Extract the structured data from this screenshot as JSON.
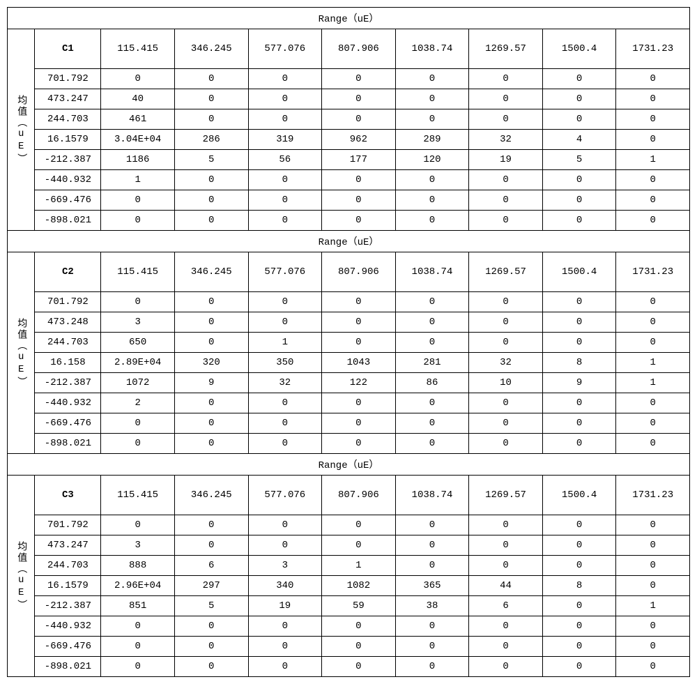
{
  "range_header": "Range（uE）",
  "vertical_label": "均值（uE）",
  "column_headers": [
    "115.415",
    "346.245",
    "577.076",
    "807.906",
    "1038.74",
    "1269.57",
    "1500.4",
    "1731.23"
  ],
  "sections": [
    {
      "name": "C1",
      "row_labels": [
        "701.792",
        "473.247",
        "244.703",
        "16.1579",
        "-212.387",
        "-440.932",
        "-669.476",
        "-898.021"
      ],
      "rows": [
        [
          "0",
          "0",
          "0",
          "0",
          "0",
          "0",
          "0",
          "0"
        ],
        [
          "40",
          "0",
          "0",
          "0",
          "0",
          "0",
          "0",
          "0"
        ],
        [
          "461",
          "0",
          "0",
          "0",
          "0",
          "0",
          "0",
          "0"
        ],
        [
          "3.04E+04",
          "286",
          "319",
          "962",
          "289",
          "32",
          "4",
          "0"
        ],
        [
          "1186",
          "5",
          "56",
          "177",
          "120",
          "19",
          "5",
          "1"
        ],
        [
          "1",
          "0",
          "0",
          "0",
          "0",
          "0",
          "0",
          "0"
        ],
        [
          "0",
          "0",
          "0",
          "0",
          "0",
          "0",
          "0",
          "0"
        ],
        [
          "0",
          "0",
          "0",
          "0",
          "0",
          "0",
          "0",
          "0"
        ]
      ]
    },
    {
      "name": "C2",
      "row_labels": [
        "701.792",
        "473.248",
        "244.703",
        "16.158",
        "-212.387",
        "-440.932",
        "-669.476",
        "-898.021"
      ],
      "rows": [
        [
          "0",
          "0",
          "0",
          "0",
          "0",
          "0",
          "0",
          "0"
        ],
        [
          "3",
          "0",
          "0",
          "0",
          "0",
          "0",
          "0",
          "0"
        ],
        [
          "650",
          "0",
          "1",
          "0",
          "0",
          "0",
          "0",
          "0"
        ],
        [
          "2.89E+04",
          "320",
          "350",
          "1043",
          "281",
          "32",
          "8",
          "1"
        ],
        [
          "1072",
          "9",
          "32",
          "122",
          "86",
          "10",
          "9",
          "1"
        ],
        [
          "2",
          "0",
          "0",
          "0",
          "0",
          "0",
          "0",
          "0"
        ],
        [
          "0",
          "0",
          "0",
          "0",
          "0",
          "0",
          "0",
          "0"
        ],
        [
          "0",
          "0",
          "0",
          "0",
          "0",
          "0",
          "0",
          "0"
        ]
      ]
    },
    {
      "name": "C3",
      "row_labels": [
        "701.792",
        "473.247",
        "244.703",
        "16.1579",
        "-212.387",
        "-440.932",
        "-669.476",
        "-898.021"
      ],
      "rows": [
        [
          "0",
          "0",
          "0",
          "0",
          "0",
          "0",
          "0",
          "0"
        ],
        [
          "3",
          "0",
          "0",
          "0",
          "0",
          "0",
          "0",
          "0"
        ],
        [
          "888",
          "6",
          "3",
          "1",
          "0",
          "0",
          "0",
          "0"
        ],
        [
          "2.96E+04",
          "297",
          "340",
          "1082",
          "365",
          "44",
          "8",
          "0"
        ],
        [
          "851",
          "5",
          "19",
          "59",
          "38",
          "6",
          "0",
          "1"
        ],
        [
          "0",
          "0",
          "0",
          "0",
          "0",
          "0",
          "0",
          "0"
        ],
        [
          "0",
          "0",
          "0",
          "0",
          "0",
          "0",
          "0",
          "0"
        ],
        [
          "0",
          "0",
          "0",
          "0",
          "0",
          "0",
          "0",
          "0"
        ]
      ]
    }
  ]
}
